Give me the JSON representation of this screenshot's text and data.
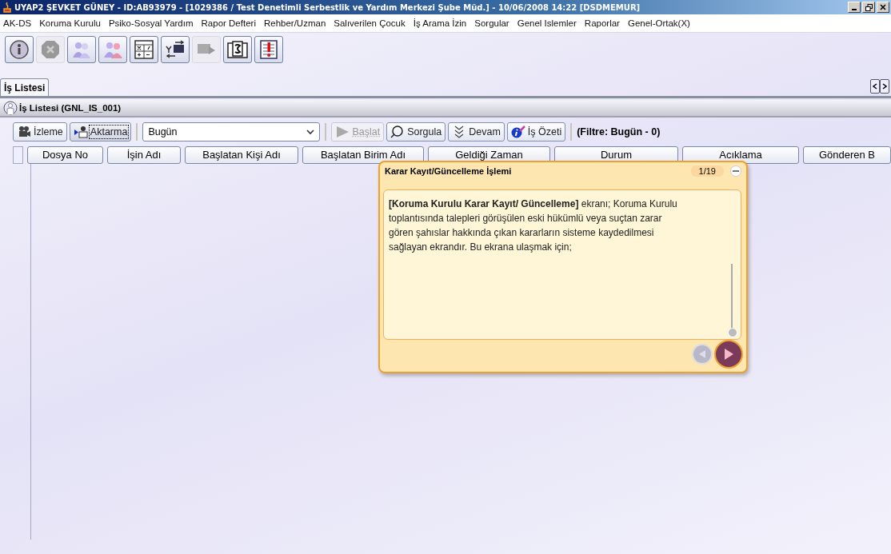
{
  "window": {
    "title": "UYAP2  ŞEVKET GÜNEY - ID:AB93979 - [1029386 / Test Denetimli Serbestlik ve Yardım Merkezi Şube Müd.] - 10/06/2008 14:22 [DSDMEMUR]"
  },
  "menu": [
    "AK-DS",
    "Koruma Kurulu",
    "Psiko-Sosyal Yardım",
    "Rapor Defteri",
    "Rehber/Uzman",
    "Salıverilen Çocuk",
    "İş Arama İzin",
    "Sorgular",
    "Genel Islemler",
    "Raporlar",
    "Genel-Ortak(X)"
  ],
  "toolbar": [
    {
      "kind": "info",
      "disabled": false
    },
    {
      "kind": "stop",
      "disabled": true
    },
    {
      "kind": "people",
      "disabled": false
    },
    {
      "kind": "pair",
      "disabled": false
    },
    {
      "kind": "calculator",
      "disabled": false
    },
    {
      "kind": "exchange",
      "disabled": false
    },
    {
      "kind": "forward",
      "disabled": true
    },
    {
      "kind": "book",
      "disabled": false
    },
    {
      "kind": "alert",
      "disabled": false
    }
  ],
  "tabs": [
    {
      "label": "İş Listesi",
      "selected": true
    }
  ],
  "panel": {
    "title": "İş Listesi (GNL_IS_001)"
  },
  "actions": [
    {
      "kind": "camera",
      "label": "İzleme",
      "disabled": false,
      "focused": false
    },
    {
      "kind": "transfer",
      "label": "Aktarma",
      "disabled": false,
      "focused": true
    },
    {
      "kind": "dropdown",
      "label": "Bugün"
    },
    {
      "kind": "play",
      "label": "Başlat",
      "disabled": true,
      "focused": false
    },
    {
      "kind": "search",
      "label": "Sorgula",
      "disabled": false,
      "focused": false
    },
    {
      "kind": "more",
      "label": "Devam",
      "disabled": false,
      "focused": false
    },
    {
      "kind": "info",
      "label": "İş Özeti",
      "disabled": false,
      "focused": false
    }
  ],
  "filter": "(Filtre: Bugün - 0)",
  "columns": [
    "Dosya No",
    "İşin Adı",
    "Başlatan Kişi Adı",
    "Başlatan Birim Adı",
    "Geldiği Zaman",
    "Durum",
    "Acıklama",
    "Gönderen B"
  ],
  "tip": {
    "title": "Karar Kayıt/Güncelleme İşlemi",
    "counter": "1/19",
    "text": "**[Koruma Kurulu Karar Kayıt/ Güncelleme]** ekranı; Koruma Kurulu toplantısında talepleri görüşülen eski hükümlü veya suçtan zarar gören şahıslar hakkında çıkan kararların sisteme kaydedilmesi sağlayan ekrandır. Bu ekrana ulaşmak için;",
    "nav": [
      {
        "kind": "prev",
        "disabled": true
      },
      {
        "kind": "next",
        "disabled": false
      }
    ]
  }
}
